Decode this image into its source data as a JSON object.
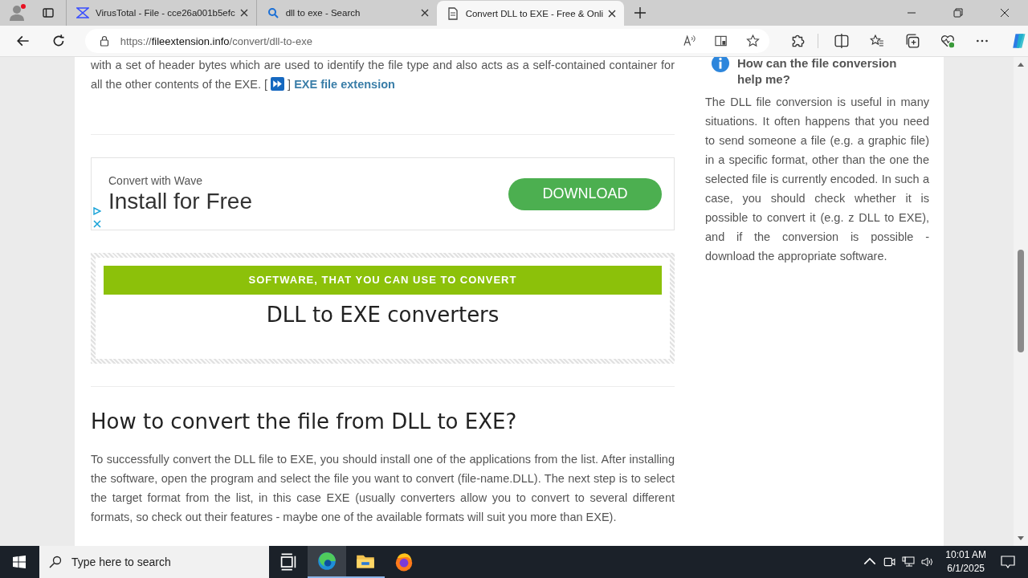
{
  "browser": {
    "tabs": [
      {
        "kind": "virustotal",
        "title": "VirusTotal - File - cce26a001b5efc",
        "selected": false
      },
      {
        "kind": "search",
        "title": "dll to exe - Search",
        "selected": false
      },
      {
        "kind": "page",
        "title": "Convert DLL to EXE - Free & Onli",
        "selected": true
      }
    ],
    "address": {
      "scheme": "https://",
      "domain": "fileextension.info",
      "path": "/convert/dll-to-exe"
    }
  },
  "article": {
    "intro_text": "with a set of header bytes which are used to identify the file type and also acts as a self-contained container for all the other contents of the EXE. [",
    "intro_close": "]",
    "intro_link": "EXE file extension",
    "ad": {
      "caption": "Convert with Wave",
      "headline": "Install for Free",
      "button": "DOWNLOAD"
    },
    "software_box": {
      "banner": "SOFTWARE, THAT YOU CAN USE TO CONVERT",
      "title": "DLL to EXE converters"
    },
    "heading": "How to convert the file from DLL to EXE?",
    "paragraph": "To successfully convert the DLL file to EXE, you should install one of the applications from the list. After installing the software, open the program and select the file you want to convert (file-name.DLL). The next step is to select the target format from the list, in this case EXE (usually converters allow you to convert to several different formats, so check out their features - maybe one of the available formats will suit you more than EXE)."
  },
  "sidebar": {
    "heading": "How can the file conversion help me?",
    "paragraph": "The DLL file conversion is useful in many situations. It often happens that you need to send someone a file (e.g. a graphic file) in a specific format, other than the one the selected file is currently encoded. In such a case, you should check whether it is possible to convert it (e.g. z DLL to EXE), and if the conversion is possible - download the appropriate software."
  },
  "taskbar": {
    "search_placeholder": "Type here to search",
    "apps": [
      {
        "kind": "taskview",
        "selected": false
      },
      {
        "kind": "edge",
        "selected": true
      },
      {
        "kind": "explorer",
        "selected": false
      },
      {
        "kind": "firefox",
        "selected": false
      }
    ],
    "time": "10:01 AM",
    "date": "6/1/2025"
  }
}
